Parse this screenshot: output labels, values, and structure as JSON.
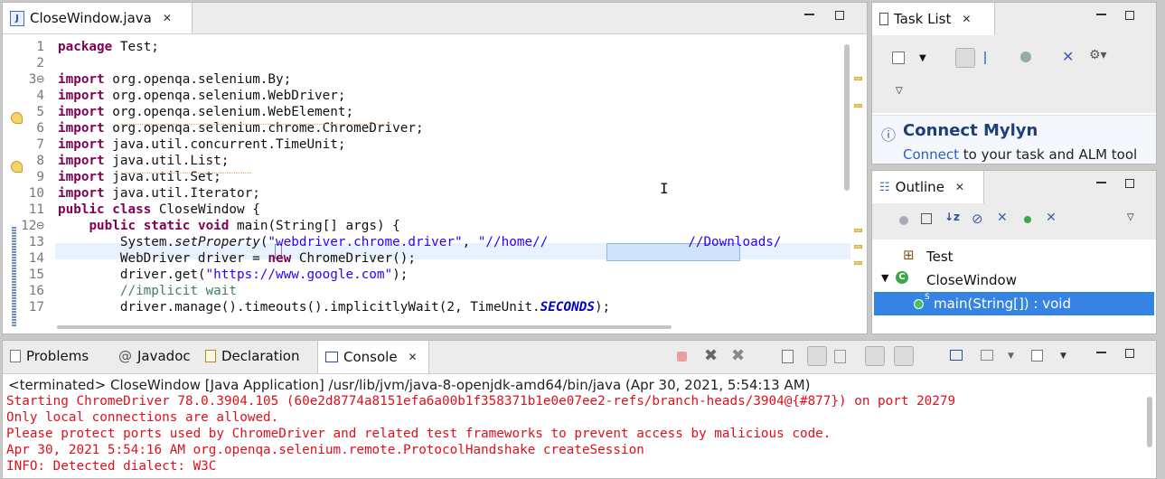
{
  "editor": {
    "tab_label": "CloseWindow.java",
    "lines": [
      {
        "num": "1",
        "parts": [
          [
            "kw",
            "package"
          ],
          [
            "",
            " Test;"
          ]
        ]
      },
      {
        "num": "2",
        "parts": []
      },
      {
        "num": "3⊖",
        "parts": [
          [
            "kw",
            "import"
          ],
          [
            "",
            " org.openqa.selenium.By;"
          ]
        ]
      },
      {
        "num": "4",
        "parts": [
          [
            "kw",
            "import"
          ],
          [
            "",
            " org.openqa.selenium.WebDriver;"
          ]
        ]
      },
      {
        "num": "5",
        "parts": [
          [
            "kw",
            "import"
          ],
          [
            "",
            " org.openqa.selenium.WebElement;"
          ]
        ]
      },
      {
        "num": "6",
        "parts": [
          [
            "kw",
            "import"
          ],
          [
            "",
            " org.openqa.selenium.chrome.ChromeDriver;"
          ]
        ]
      },
      {
        "num": "7",
        "parts": [
          [
            "kw",
            "import"
          ],
          [
            "",
            " java.util.concurrent.TimeUnit;"
          ]
        ]
      },
      {
        "num": "8",
        "parts": [
          [
            "kw",
            "import"
          ],
          [
            "",
            " java.util.List;"
          ]
        ]
      },
      {
        "num": "9",
        "parts": [
          [
            "kw",
            "import"
          ],
          [
            "",
            " java.util.Set;"
          ]
        ]
      },
      {
        "num": "10",
        "parts": [
          [
            "kw",
            "import"
          ],
          [
            "",
            " java.util.Iterator;"
          ]
        ]
      },
      {
        "num": "11",
        "parts": [
          [
            "kw",
            "public"
          ],
          [
            "",
            " "
          ],
          [
            "kw",
            "class"
          ],
          [
            "",
            " CloseWindow {"
          ]
        ]
      },
      {
        "num": "12⊖",
        "parts": [
          [
            "",
            "    "
          ],
          [
            "kw",
            "public"
          ],
          [
            "",
            " "
          ],
          [
            "kw",
            "static"
          ],
          [
            "",
            " "
          ],
          [
            "kw",
            "void"
          ],
          [
            "",
            " main(String[] args) {"
          ]
        ]
      },
      {
        "num": "13",
        "parts": [
          [
            "",
            "        System."
          ],
          [
            "it",
            "setProperty"
          ],
          [
            "",
            "("
          ],
          [
            "str",
            "\"webdriver.chrome.driver\""
          ],
          [
            "",
            ", "
          ],
          [
            "str",
            "\"//home//"
          ],
          [
            "",
            "                  "
          ],
          [
            "str",
            "//Downloads/"
          ]
        ]
      },
      {
        "num": "14",
        "parts": [
          [
            "",
            "        WebDriver driver = "
          ],
          [
            "kw",
            "new"
          ],
          [
            "",
            " ChromeDriver();"
          ]
        ]
      },
      {
        "num": "15",
        "parts": [
          [
            "",
            "        driver.get("
          ],
          [
            "str",
            "\"https://www.google.com\""
          ],
          [
            "",
            ");"
          ]
        ]
      },
      {
        "num": "16",
        "parts": [
          [
            "cmt",
            "        //implicit wait"
          ]
        ]
      },
      {
        "num": "17",
        "parts": [
          [
            "",
            "        driver.manage().timeouts().implicitlyWait(2, TimeUnit."
          ],
          [
            "const",
            "SECONDS"
          ],
          [
            "",
            ");"
          ]
        ]
      }
    ]
  },
  "task_list": {
    "tab_label": "Task List",
    "connect_title": "Connect Mylyn",
    "connect_link": "Connect",
    "connect_text": " to your task and ALM tool"
  },
  "outline": {
    "tab_label": "Outline",
    "items": [
      {
        "label": "Test"
      },
      {
        "label": "CloseWindow"
      },
      {
        "label": "main(String[]) : void"
      }
    ]
  },
  "bottom": {
    "tabs": [
      "Problems",
      "Javadoc",
      "Declaration",
      "Console"
    ],
    "header": "<terminated> CloseWindow [Java Application] /usr/lib/jvm/java-8-openjdk-amd64/bin/java (Apr 30, 2021, 5:54:13 AM)",
    "lines": [
      "Starting ChromeDriver 78.0.3904.105 (60e2d8774a8151efa6a00b1f358371b1e0e07ee2-refs/branch-heads/3904@{#877}) on port 20279",
      "Only local connections are allowed.",
      "Please protect ports used by ChromeDriver and related test frameworks to prevent access by malicious code.",
      "Apr 30, 2021 5:54:16 AM org.openqa.selenium.remote.ProtocolHandshake createSession",
      "INFO: Detected dialect: W3C"
    ]
  },
  "colors": {
    "keyword": "#7f0055",
    "string": "#2a00ff",
    "comment": "#3f7f5f",
    "console_error": "#e0101a",
    "selection": "#3584e4"
  }
}
